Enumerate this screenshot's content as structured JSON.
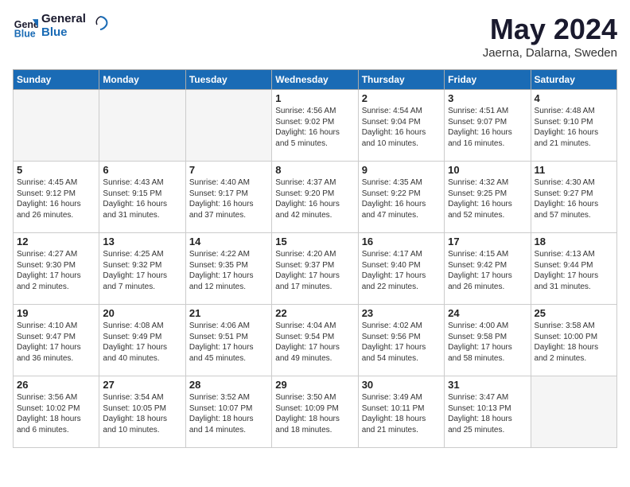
{
  "header": {
    "logo_line1": "General",
    "logo_line2": "Blue",
    "month": "May 2024",
    "location": "Jaerna, Dalarna, Sweden"
  },
  "weekdays": [
    "Sunday",
    "Monday",
    "Tuesday",
    "Wednesday",
    "Thursday",
    "Friday",
    "Saturday"
  ],
  "weeks": [
    [
      {
        "day": "",
        "text": "",
        "empty": true
      },
      {
        "day": "",
        "text": "",
        "empty": true
      },
      {
        "day": "",
        "text": "",
        "empty": true
      },
      {
        "day": "1",
        "text": "Sunrise: 4:56 AM\nSunset: 9:02 PM\nDaylight: 16 hours\nand 5 minutes."
      },
      {
        "day": "2",
        "text": "Sunrise: 4:54 AM\nSunset: 9:04 PM\nDaylight: 16 hours\nand 10 minutes."
      },
      {
        "day": "3",
        "text": "Sunrise: 4:51 AM\nSunset: 9:07 PM\nDaylight: 16 hours\nand 16 minutes."
      },
      {
        "day": "4",
        "text": "Sunrise: 4:48 AM\nSunset: 9:10 PM\nDaylight: 16 hours\nand 21 minutes."
      }
    ],
    [
      {
        "day": "5",
        "text": "Sunrise: 4:45 AM\nSunset: 9:12 PM\nDaylight: 16 hours\nand 26 minutes."
      },
      {
        "day": "6",
        "text": "Sunrise: 4:43 AM\nSunset: 9:15 PM\nDaylight: 16 hours\nand 31 minutes."
      },
      {
        "day": "7",
        "text": "Sunrise: 4:40 AM\nSunset: 9:17 PM\nDaylight: 16 hours\nand 37 minutes."
      },
      {
        "day": "8",
        "text": "Sunrise: 4:37 AM\nSunset: 9:20 PM\nDaylight: 16 hours\nand 42 minutes."
      },
      {
        "day": "9",
        "text": "Sunrise: 4:35 AM\nSunset: 9:22 PM\nDaylight: 16 hours\nand 47 minutes."
      },
      {
        "day": "10",
        "text": "Sunrise: 4:32 AM\nSunset: 9:25 PM\nDaylight: 16 hours\nand 52 minutes."
      },
      {
        "day": "11",
        "text": "Sunrise: 4:30 AM\nSunset: 9:27 PM\nDaylight: 16 hours\nand 57 minutes."
      }
    ],
    [
      {
        "day": "12",
        "text": "Sunrise: 4:27 AM\nSunset: 9:30 PM\nDaylight: 17 hours\nand 2 minutes."
      },
      {
        "day": "13",
        "text": "Sunrise: 4:25 AM\nSunset: 9:32 PM\nDaylight: 17 hours\nand 7 minutes."
      },
      {
        "day": "14",
        "text": "Sunrise: 4:22 AM\nSunset: 9:35 PM\nDaylight: 17 hours\nand 12 minutes."
      },
      {
        "day": "15",
        "text": "Sunrise: 4:20 AM\nSunset: 9:37 PM\nDaylight: 17 hours\nand 17 minutes."
      },
      {
        "day": "16",
        "text": "Sunrise: 4:17 AM\nSunset: 9:40 PM\nDaylight: 17 hours\nand 22 minutes."
      },
      {
        "day": "17",
        "text": "Sunrise: 4:15 AM\nSunset: 9:42 PM\nDaylight: 17 hours\nand 26 minutes."
      },
      {
        "day": "18",
        "text": "Sunrise: 4:13 AM\nSunset: 9:44 PM\nDaylight: 17 hours\nand 31 minutes."
      }
    ],
    [
      {
        "day": "19",
        "text": "Sunrise: 4:10 AM\nSunset: 9:47 PM\nDaylight: 17 hours\nand 36 minutes."
      },
      {
        "day": "20",
        "text": "Sunrise: 4:08 AM\nSunset: 9:49 PM\nDaylight: 17 hours\nand 40 minutes."
      },
      {
        "day": "21",
        "text": "Sunrise: 4:06 AM\nSunset: 9:51 PM\nDaylight: 17 hours\nand 45 minutes."
      },
      {
        "day": "22",
        "text": "Sunrise: 4:04 AM\nSunset: 9:54 PM\nDaylight: 17 hours\nand 49 minutes."
      },
      {
        "day": "23",
        "text": "Sunrise: 4:02 AM\nSunset: 9:56 PM\nDaylight: 17 hours\nand 54 minutes."
      },
      {
        "day": "24",
        "text": "Sunrise: 4:00 AM\nSunset: 9:58 PM\nDaylight: 17 hours\nand 58 minutes."
      },
      {
        "day": "25",
        "text": "Sunrise: 3:58 AM\nSunset: 10:00 PM\nDaylight: 18 hours\nand 2 minutes."
      }
    ],
    [
      {
        "day": "26",
        "text": "Sunrise: 3:56 AM\nSunset: 10:02 PM\nDaylight: 18 hours\nand 6 minutes."
      },
      {
        "day": "27",
        "text": "Sunrise: 3:54 AM\nSunset: 10:05 PM\nDaylight: 18 hours\nand 10 minutes."
      },
      {
        "day": "28",
        "text": "Sunrise: 3:52 AM\nSunset: 10:07 PM\nDaylight: 18 hours\nand 14 minutes."
      },
      {
        "day": "29",
        "text": "Sunrise: 3:50 AM\nSunset: 10:09 PM\nDaylight: 18 hours\nand 18 minutes."
      },
      {
        "day": "30",
        "text": "Sunrise: 3:49 AM\nSunset: 10:11 PM\nDaylight: 18 hours\nand 21 minutes."
      },
      {
        "day": "31",
        "text": "Sunrise: 3:47 AM\nSunset: 10:13 PM\nDaylight: 18 hours\nand 25 minutes."
      },
      {
        "day": "",
        "text": "",
        "empty": true
      }
    ]
  ]
}
